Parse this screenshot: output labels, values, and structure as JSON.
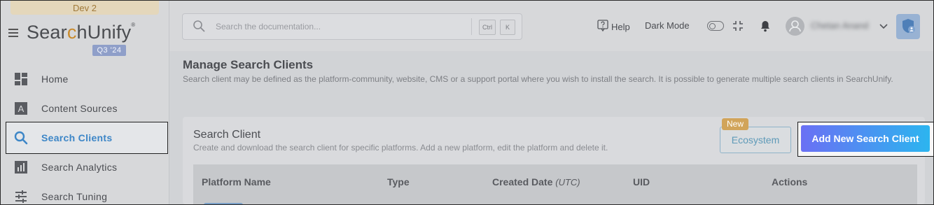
{
  "sidebar": {
    "env_badge": "Dev 2",
    "logo": {
      "part1": "Sear",
      "accent": "c",
      "part2": "hUnify",
      "reg": "®"
    },
    "version": "Q3 '24",
    "items": [
      {
        "label": "Home",
        "icon": "dashboard-icon"
      },
      {
        "label": "Content Sources",
        "icon": "content-sources-icon"
      },
      {
        "label": "Search Clients",
        "icon": "search-icon",
        "active": true
      },
      {
        "label": "Search Analytics",
        "icon": "analytics-icon"
      },
      {
        "label": "Search Tuning",
        "icon": "tuning-icon"
      }
    ]
  },
  "topbar": {
    "search_placeholder": "Search the documentation...",
    "kbd_ctrl": "Ctrl",
    "kbd_k": "K",
    "help": "Help",
    "dark_mode": "Dark Mode",
    "username": "Chetan Anand"
  },
  "main": {
    "title": "Manage Search Clients",
    "description": "Search client may be defined as the platform-community, website, CMS or a support portal where you wish to install the search. It is possible to generate multiple search clients in SearchUnify.",
    "card": {
      "title": "Search Client",
      "description": "Create and download the search client for specific platforms. Add a new platform, edit the platform and delete it.",
      "new_badge": "New",
      "ecosystem_label": "Ecosystem",
      "add_label": "Add New Search Client",
      "columns": [
        "Platform Name",
        "Type",
        "Created Date",
        "UID",
        "Actions"
      ],
      "utc": "(UTC)"
    }
  },
  "colors": {
    "accent": "#3d86c7",
    "gradient_start": "#6a70f4",
    "gradient_end": "#2cb5ef",
    "new_badge": "#d1a45a"
  }
}
